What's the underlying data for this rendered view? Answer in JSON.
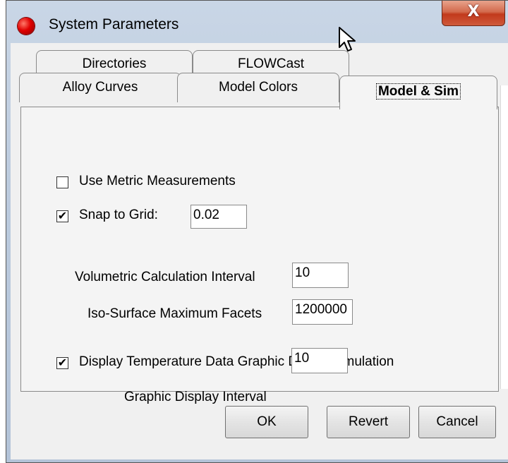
{
  "window": {
    "title": "System Parameters",
    "close_label": "X"
  },
  "tabs": {
    "directories": "Directories",
    "flowcast": "FLOWCast",
    "alloy_curves": "Alloy Curves",
    "model_colors": "Model Colors",
    "model_sim": "Model & Sim"
  },
  "settings": {
    "metric": {
      "label": "Use Metric Measurements",
      "checked": false
    },
    "snap": {
      "label": "Snap to Grid:",
      "checked": true,
      "value": "0.02"
    },
    "volumetric": {
      "label": "Volumetric Calculation  Interval",
      "value": "10"
    },
    "iso": {
      "label": "Iso-Surface Maximum Facets",
      "value": "1200000"
    },
    "display_temp": {
      "label": "Display Temperature Data Graphic During Simulation",
      "checked": true
    },
    "graphic_interval": {
      "label": "Graphic Display Interval",
      "value": "10"
    }
  },
  "buttons": {
    "ok": "OK",
    "revert": "Revert",
    "cancel": "Cancel"
  },
  "icons": {
    "app": "red-ball-icon",
    "check": "checkmark-icon",
    "cursor": "mouse-pointer-icon"
  }
}
